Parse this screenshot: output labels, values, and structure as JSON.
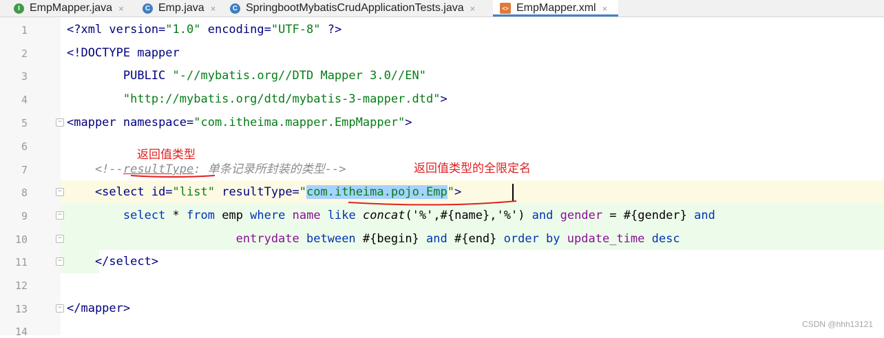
{
  "tabs": [
    {
      "label": "EmpMapper.java",
      "icon": "I",
      "icon_name": "interface-icon",
      "active": false
    },
    {
      "label": "Emp.java",
      "icon": "C",
      "icon_name": "class-icon",
      "active": false
    },
    {
      "label": "SpringbootMybatisCrudApplicationTests.java",
      "icon": "C",
      "icon_name": "test-class-icon",
      "active": false
    },
    {
      "label": "EmpMapper.xml",
      "icon": "<>",
      "icon_name": "xml-file-icon",
      "active": true
    }
  ],
  "close_glyph": "×",
  "line_numbers": [
    "1",
    "2",
    "3",
    "4",
    "5",
    "6",
    "7",
    "8",
    "9",
    "10",
    "11",
    "12",
    "13",
    "14"
  ],
  "code": {
    "l1": {
      "a": "<?xml version=",
      "b": "\"1.0\"",
      "c": " encoding=",
      "d": "\"UTF-8\"",
      "e": " ?>"
    },
    "l2": {
      "a": "<!DOCTYPE mapper"
    },
    "l3": {
      "a": "        PUBLIC ",
      "b": "\"-//mybatis.org//DTD Mapper 3.0//EN\""
    },
    "l4": {
      "a": "        ",
      "b": "\"http://mybatis.org/dtd/mybatis-3-mapper.dtd\"",
      "c": ">"
    },
    "l5": {
      "a": "<mapper ",
      "b": "namespace=",
      "c": "\"com.itheima.mapper.EmpMapper\"",
      "d": ">"
    },
    "l7": {
      "a": "    <!--",
      "b": "resultType",
      "c": ": 单条记录所封装的类型-->"
    },
    "l8": {
      "a": "    <select ",
      "b": "id=",
      "c": "\"list\"",
      "d": " resultType=",
      "e": "\"",
      "f": "com.itheima.pojo.Emp",
      "g": "\"",
      "h": ">"
    },
    "l9": {
      "a": "        ",
      "b": "select",
      "c": " * ",
      "d": "from",
      "e": " emp ",
      "f": "where",
      "g": " ",
      "h": "name",
      "i": " ",
      "j": "like",
      "k": " ",
      "l": "concat",
      "m": "('%',#{name},'%') ",
      "n": "and",
      "o": " ",
      "p": "gender",
      "q": " = #{gender} ",
      "r": "and"
    },
    "l10": {
      "a": "                        ",
      "b": "entrydate",
      "c": " ",
      "d": "between",
      "e": " #{begin} ",
      "f": "and",
      "g": " #{end} ",
      "h": "order by",
      "i": " ",
      "j": "update_time",
      "k": " ",
      "l": "desc"
    },
    "l11": {
      "a": "    </select>"
    },
    "l13": {
      "a": "</mapper>"
    }
  },
  "annotations": {
    "return_type": "返回值类型",
    "fully_qualified": "返回值类型的全限定名"
  },
  "watermark": "CSDN @hhh13121",
  "colors": {
    "accent": "#4083c9",
    "annotation": "#e02020",
    "selection": "#a6d2ff",
    "tag": "#000080",
    "string": "#067d17"
  }
}
